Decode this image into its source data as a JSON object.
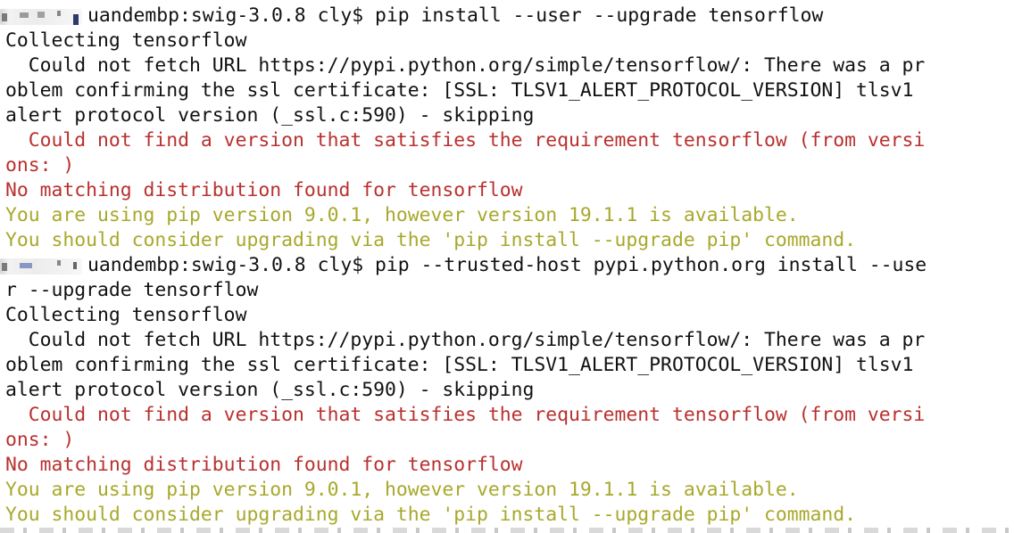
{
  "terminal": {
    "lines": [
      {
        "text": "uandembp:swig-3.0.8 cly$ pip install --user --upgrade tensorflow",
        "color": "#111111"
      },
      {
        "text": "Collecting tensorflow",
        "color": "#111111"
      },
      {
        "text": "  Could not fetch URL https://pypi.python.org/simple/tensorflow/: There was a pr",
        "color": "#111111"
      },
      {
        "text": "oblem confirming the ssl certificate: [SSL: TLSV1_ALERT_PROTOCOL_VERSION] tlsv1",
        "color": "#111111"
      },
      {
        "text": "alert protocol version (_ssl.c:590) - skipping",
        "color": "#111111"
      },
      {
        "text": "  Could not find a version that satisfies the requirement tensorflow (from versi",
        "color": "#b8312f"
      },
      {
        "text": "ons: )",
        "color": "#b8312f"
      },
      {
        "text": "No matching distribution found for tensorflow",
        "color": "#b8312f"
      },
      {
        "text": "You are using pip version 9.0.1, however version 19.1.1 is available.",
        "color": "#a8a82c"
      },
      {
        "text": "You should consider upgrading via the 'pip install --upgrade pip' command.",
        "color": "#a8a82c"
      },
      {
        "text": "uandembp:swig-3.0.8 cly$ pip --trusted-host pypi.python.org install --use",
        "color": "#111111"
      },
      {
        "text": "r --upgrade tensorflow",
        "color": "#111111"
      },
      {
        "text": "Collecting tensorflow",
        "color": "#111111"
      },
      {
        "text": "  Could not fetch URL https://pypi.python.org/simple/tensorflow/: There was a pr",
        "color": "#111111"
      },
      {
        "text": "oblem confirming the ssl certificate: [SSL: TLSV1_ALERT_PROTOCOL_VERSION] tlsv1",
        "color": "#111111"
      },
      {
        "text": "alert protocol version (_ssl.c:590) - skipping",
        "color": "#111111"
      },
      {
        "text": "  Could not find a version that satisfies the requirement tensorflow (from versi",
        "color": "#b8312f"
      },
      {
        "text": "ons: )",
        "color": "#b8312f"
      },
      {
        "text": "No matching distribution found for tensorflow",
        "color": "#b8312f"
      },
      {
        "text": "You are using pip version 9.0.1, however version 19.1.1 is available.",
        "color": "#a8a82c"
      },
      {
        "text": "You should consider upgrading via the 'pip install --upgrade pip' command.",
        "color": "#a8a82c"
      }
    ]
  },
  "colors": {
    "background": "#ffffff",
    "normal": "#111111",
    "error": "#b8312f",
    "warning": "#a8a82c"
  }
}
